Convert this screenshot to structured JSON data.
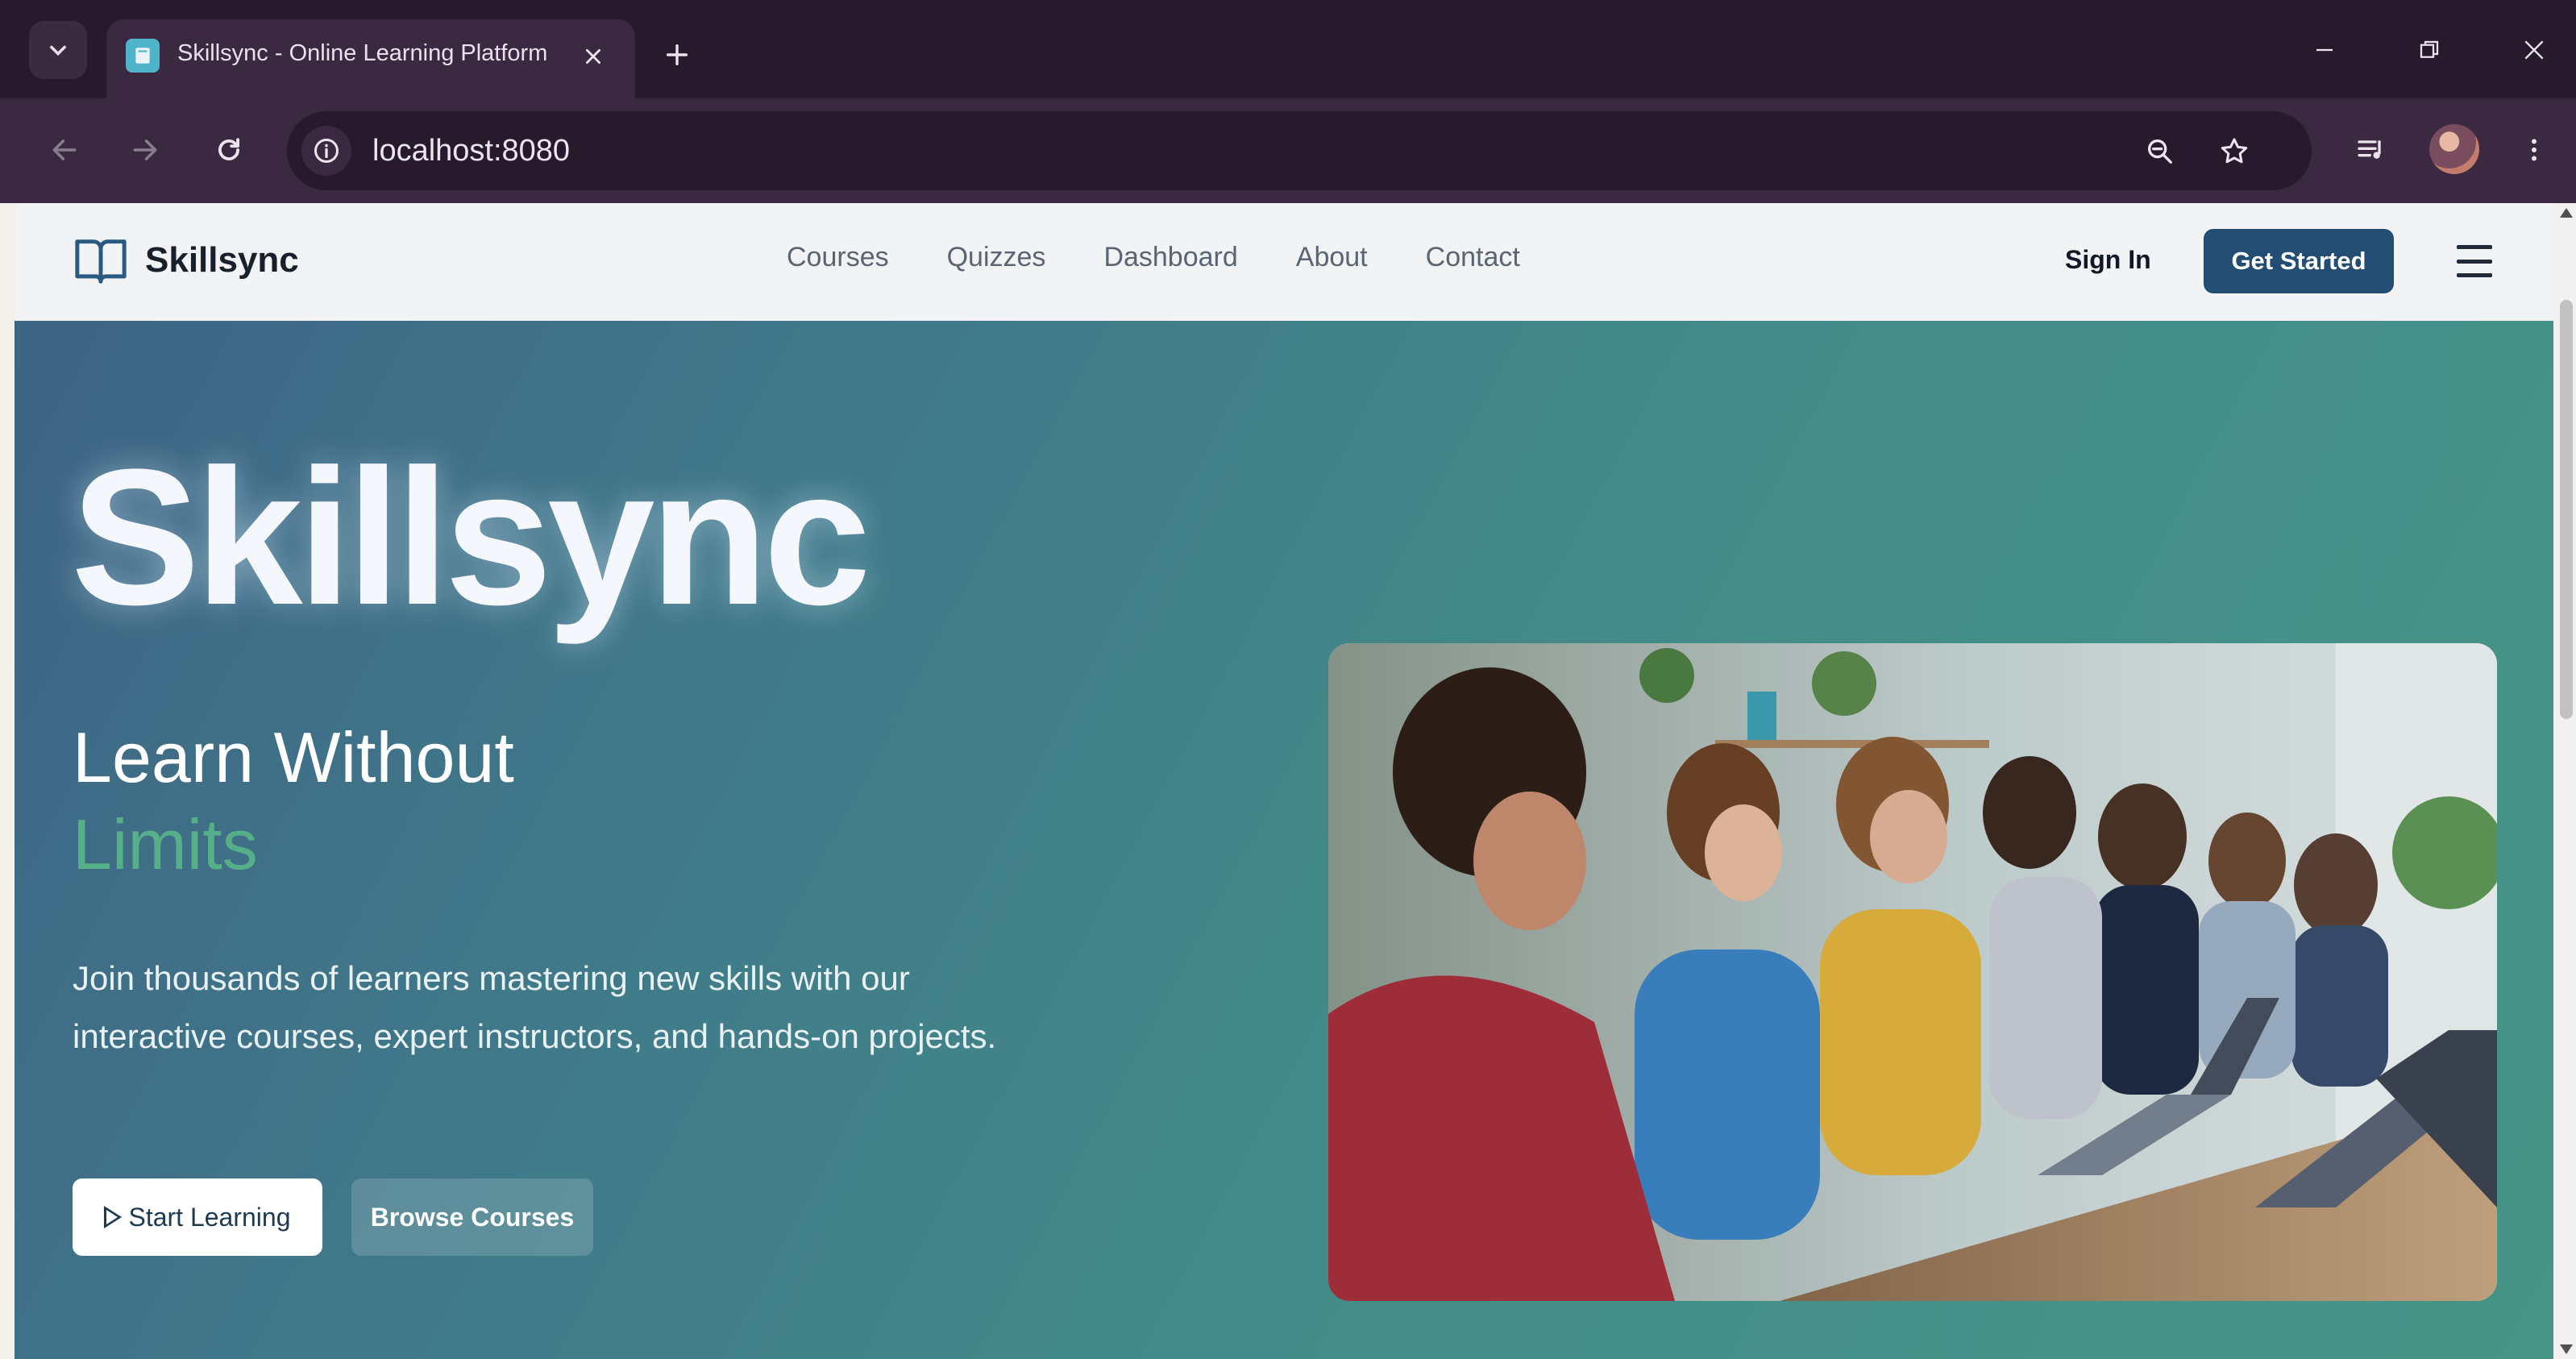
{
  "browser": {
    "tab_title": "Skillsync - Online Learning Platform",
    "url": "localhost:8080",
    "colors": {
      "frame": "#271a2d",
      "toolbar": "#3a2940"
    }
  },
  "site": {
    "brand": "Skillsync",
    "nav": [
      "Courses",
      "Quizzes",
      "Dashboard",
      "About",
      "Contact"
    ],
    "sign_in": "Sign In",
    "get_started": "Get Started"
  },
  "hero": {
    "brand": "Skillsync",
    "heading_line1": "Learn Without",
    "heading_line2": "Limits",
    "paragraph": "Join thousands of learners mastering new skills with our interactive courses, expert instructors, and hands-on projects.",
    "start_learning": "Start Learning",
    "browse_courses": "Browse Courses",
    "colors": {
      "accent_green": "#55b089",
      "button_dark": "#244d73"
    }
  }
}
